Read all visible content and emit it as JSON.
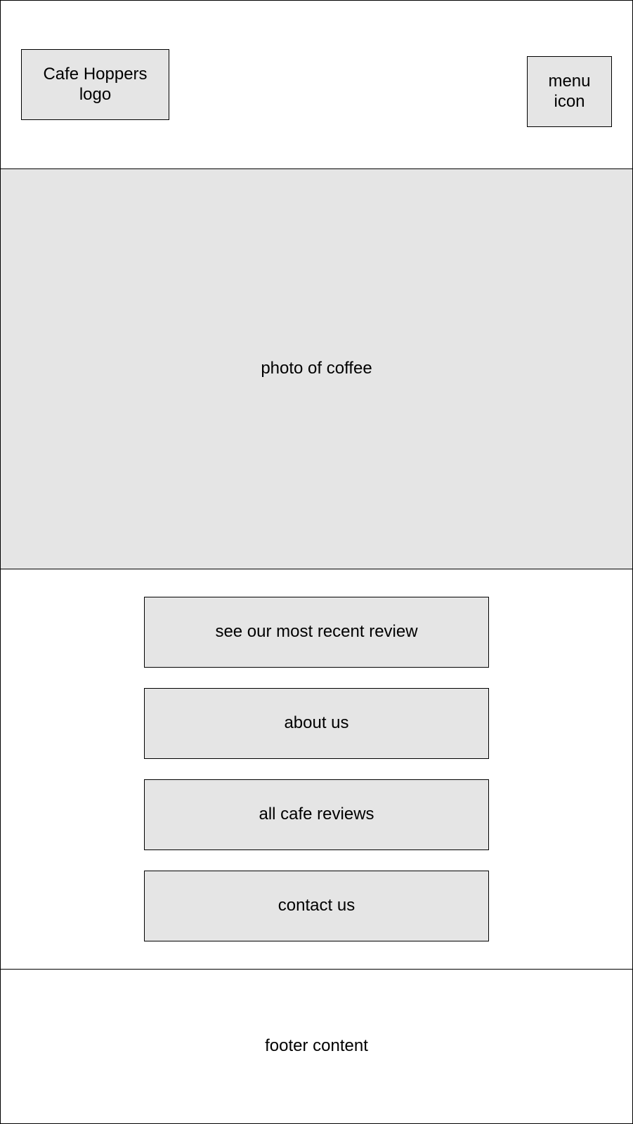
{
  "header": {
    "logo_label": "Cafe Hoppers logo",
    "menu_label": "menu icon"
  },
  "hero": {
    "label": "photo of coffee"
  },
  "nav": {
    "buttons": [
      {
        "label": "see our most recent review"
      },
      {
        "label": "about us"
      },
      {
        "label": "all cafe reviews"
      },
      {
        "label": "contact us"
      }
    ]
  },
  "footer": {
    "label": "footer content"
  },
  "colors": {
    "placeholder_fill": "#e5e5e5",
    "border": "#000000",
    "background": "#ffffff"
  }
}
